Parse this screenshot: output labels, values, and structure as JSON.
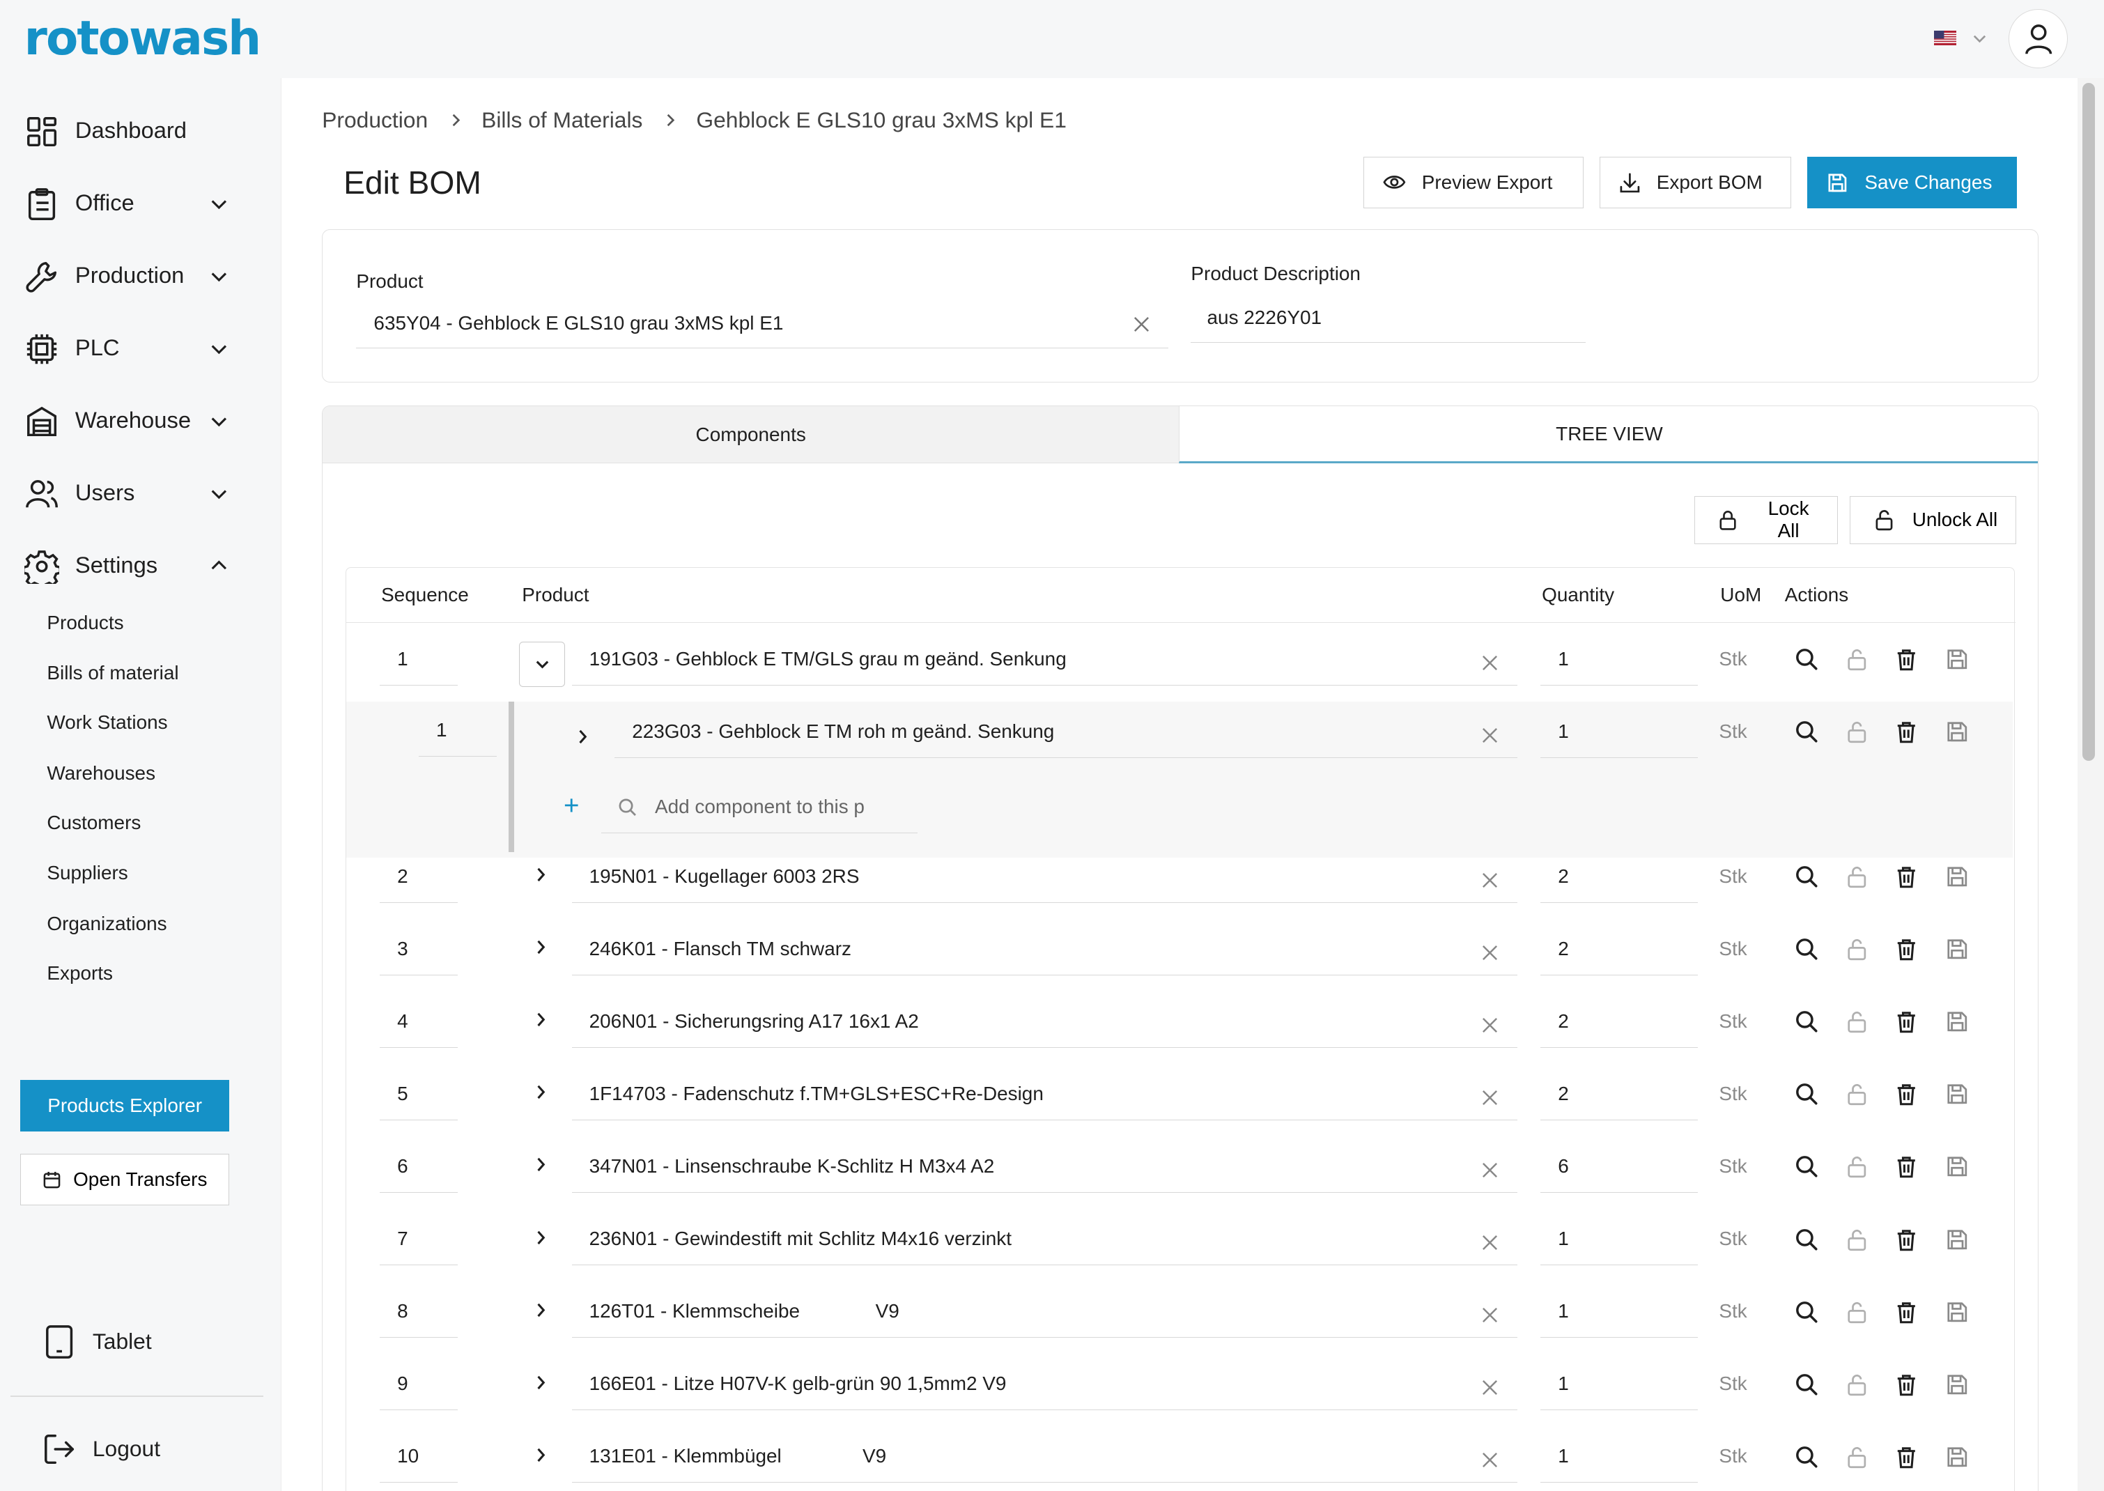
{
  "brand": {
    "logo_text": "rotowash",
    "accent_color": "#1591c7"
  },
  "header": {
    "language_icon": "us-flag-icon",
    "user_icon": "user-icon"
  },
  "sidebar": {
    "items": [
      {
        "label": "Dashboard",
        "icon": "dashboard-icon"
      },
      {
        "label": "Office",
        "icon": "clipboard-icon"
      },
      {
        "label": "Production",
        "icon": "wrench-icon"
      },
      {
        "label": "PLC",
        "icon": "chip-icon"
      },
      {
        "label": "Warehouse",
        "icon": "warehouse-icon"
      },
      {
        "label": "Users",
        "icon": "users-icon"
      },
      {
        "label": "Settings",
        "icon": "gear-icon"
      }
    ],
    "settings_subitems": [
      "Products",
      "Bills of material",
      "Work Stations",
      "Warehouses",
      "Customers",
      "Suppliers",
      "Organizations",
      "Exports"
    ],
    "products_explorer_label": "Products Explorer",
    "open_transfers_label": "Open Transfers",
    "tablet_label": "Tablet",
    "logout_label": "Logout"
  },
  "breadcrumb": [
    "Production",
    "Bills of Materials",
    "Gehblock E GLS10 grau 3xMS kpl E1"
  ],
  "page": {
    "title": "Edit BOM",
    "preview_export_label": "Preview Export",
    "export_bom_label": "Export BOM",
    "save_changes_label": "Save Changes"
  },
  "product_form": {
    "product_label": "Product",
    "product_value": "635Y04 - Gehblock E GLS10 grau 3xMS kpl E1",
    "description_label": "Product Description",
    "description_value": "aus 2226Y01"
  },
  "tabs": {
    "components": "Components",
    "tree_view": "TREE VIEW",
    "active": "TREE VIEW"
  },
  "tree_toolbar": {
    "lock_all": "Lock All",
    "unlock_all": "Unlock All"
  },
  "table": {
    "headers": {
      "sequence": "Sequence",
      "product": "Product",
      "quantity": "Quantity",
      "uom": "UoM",
      "actions": "Actions"
    },
    "rows": [
      {
        "seq": "1",
        "product": "191G03 - Gehblock E TM/GLS grau m geänd. Senkung",
        "qty": "1",
        "uom": "Stk",
        "expanded": true
      },
      {
        "seq": "2",
        "product": "195N01 - Kugellager 6003 2RS",
        "qty": "2",
        "uom": "Stk"
      },
      {
        "seq": "3",
        "product": "246K01 - Flansch TM schwarz",
        "qty": "2",
        "uom": "Stk"
      },
      {
        "seq": "4",
        "product": "206N01 - Sicherungsring A17 16x1 A2",
        "qty": "2",
        "uom": "Stk"
      },
      {
        "seq": "5",
        "product": "1F14703 - Fadenschutz f.TM+GLS+ESC+Re-Design",
        "qty": "2",
        "uom": "Stk"
      },
      {
        "seq": "6",
        "product": "347N01 - Linsenschraube K-Schlitz H M3x4 A2",
        "qty": "6",
        "uom": "Stk"
      },
      {
        "seq": "7",
        "product": "236N01 - Gewindestift mit Schlitz M4x16 verzinkt",
        "qty": "1",
        "uom": "Stk"
      },
      {
        "seq": "8",
        "product": "126T01 - Klemmscheibe              V9",
        "qty": "1",
        "uom": "Stk"
      },
      {
        "seq": "9",
        "product": "166E01 - Litze H07V-K gelb-grün 90 1,5mm2 V9",
        "qty": "1",
        "uom": "Stk"
      },
      {
        "seq": "10",
        "product": "131E01 - Klemmbügel               V9",
        "qty": "1",
        "uom": "Stk"
      }
    ],
    "child_row": {
      "seq": "1",
      "product": "223G03 - Gehblock E TM roh m geänd. Senkung",
      "qty": "1",
      "uom": "Stk"
    },
    "add_component_placeholder": "Add component to this p"
  }
}
